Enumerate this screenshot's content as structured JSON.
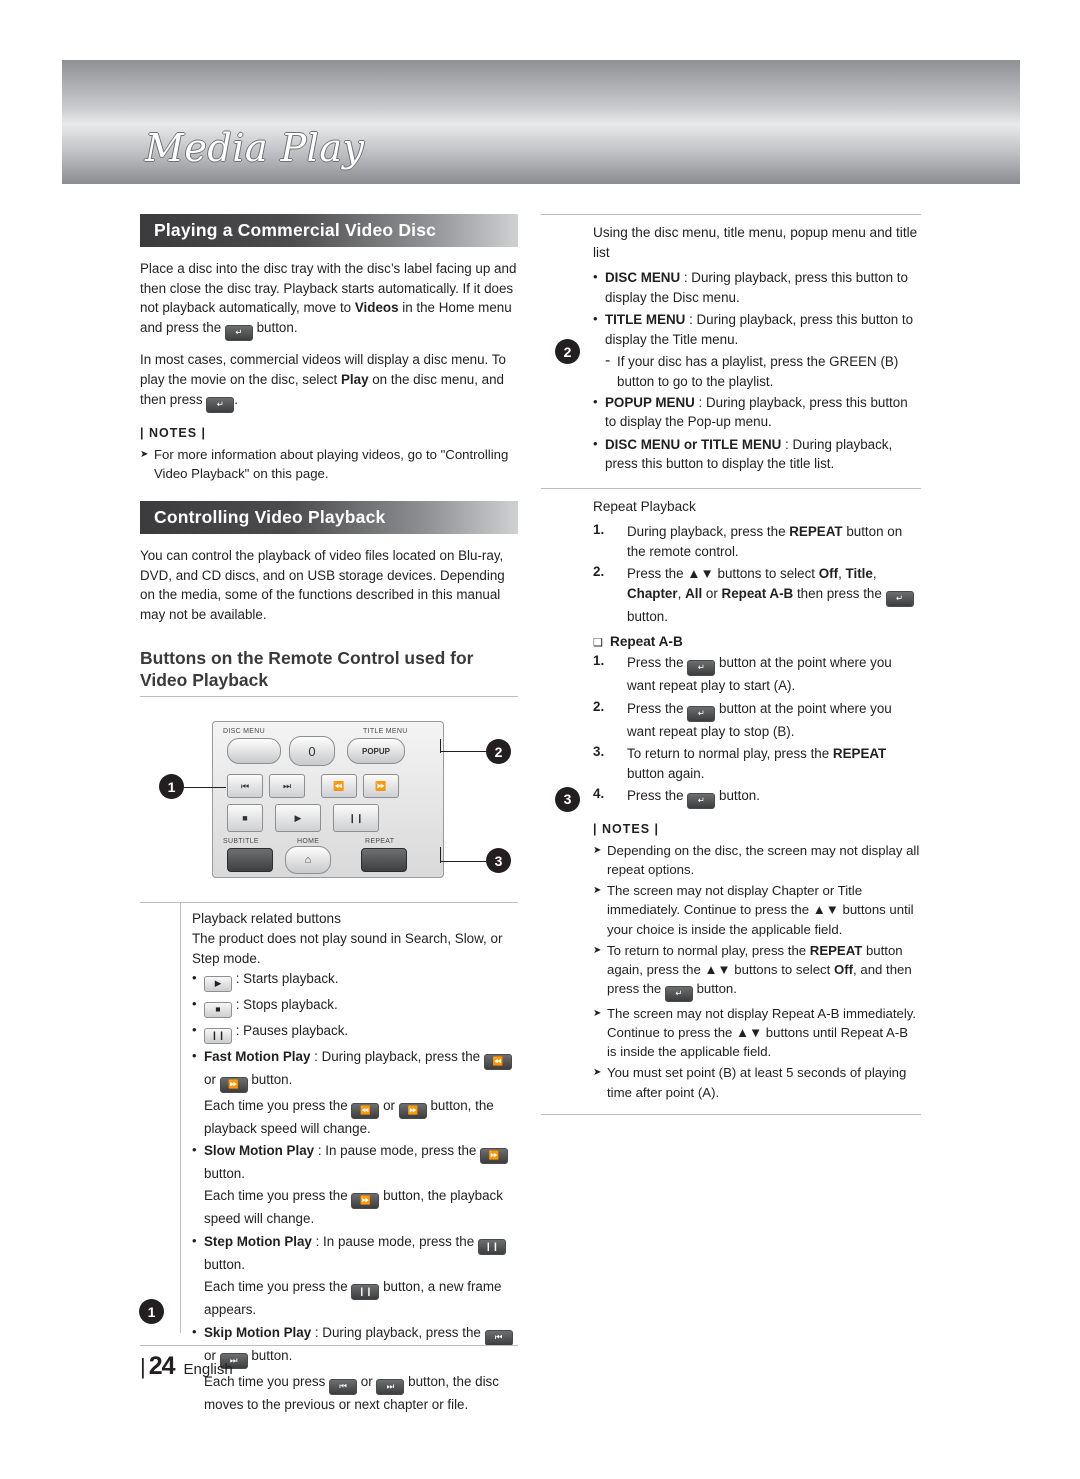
{
  "header": {
    "title": "Media Play"
  },
  "left": {
    "section1_title": "Playing a Commercial Video Disc",
    "p1": "Place a disc into the disc tray with the disc’s label facing up and then close the disc tray. Playback starts automatically. If it does not playback automatically, move to Videos in the Home menu and press the  button.",
    "p1_parts": {
      "a": "Place a disc into the disc tray with the disc’s label facing up and then close the disc tray. Playback starts automatically. If it does not playback automatically, move to ",
      "videos": "Videos",
      "b": " in the Home menu and press the ",
      "c": " button."
    },
    "p2_parts": {
      "a": "In most cases, commercial videos will display a disc menu. To play the movie on the disc, select ",
      "play": "Play",
      "b": " on the disc menu, and then press ",
      "c": "."
    },
    "notes_label": "NOTES",
    "note1": "For more information about playing videos, go to \"Controlling Video Playback\" on this page.",
    "section2_title": "Controlling Video Playback",
    "p3": "You can control the playback of video files located on Blu-ray, DVD, and CD discs, and on USB storage devices. Depending on the media, some of the functions described in this manual may not be available.",
    "section3_title": "Buttons on the Remote Control used for Video Playback",
    "remote": {
      "label_disc_menu": "DISC MENU",
      "label_title_menu": "TITLE MENU",
      "label_popup": "POPUP",
      "label_zero": "0",
      "label_subtitle": "SUBTITLE",
      "label_home": "HOME",
      "label_repeat": "REPEAT",
      "callout1": "1",
      "callout2": "2",
      "callout3": "3"
    },
    "panel": {
      "marker": "1",
      "title": "Playback related buttons",
      "intro": "The product does not play sound in Search, Slow, or Step mode.",
      "items": [
        {
          "kind": "bullet",
          "icon": "play",
          "text": ": Starts playback."
        },
        {
          "kind": "bullet",
          "icon": "stop",
          "text": ": Stops playback."
        },
        {
          "kind": "bullet",
          "icon": "pause",
          "text": ": Pauses playback."
        },
        {
          "kind": "bullet_bold",
          "bold": "Fast Motion Play",
          "text": " : During playback, press the  or  button."
        },
        {
          "kind": "sub",
          "text": "Each time you press the  or  button, the playback speed will change."
        },
        {
          "kind": "bullet_bold",
          "bold": "Slow Motion Play",
          "text": " : In pause mode, press the  button."
        },
        {
          "kind": "sub",
          "text": "Each time you press the  button, the playback speed will change."
        },
        {
          "kind": "bullet_bold",
          "bold": "Step Motion Play",
          "text": " : In pause mode, press the  button."
        },
        {
          "kind": "sub",
          "text": "Each time you press the  button, a new frame appears."
        },
        {
          "kind": "bullet_bold",
          "bold": "Skip Motion Play",
          "text": " : During playback, press the  or  button."
        },
        {
          "kind": "sub",
          "text": "Each time you press  or  button, the disc moves to the previous or next chapter or file."
        }
      ]
    }
  },
  "right": {
    "marker2": "2",
    "marker3": "3",
    "block1_head": "Using the disc menu, title menu, popup menu and title list",
    "block1_items": [
      {
        "bold": "DISC MENU",
        "text": " : During playback, press this button to display the Disc menu."
      },
      {
        "bold": "TITLE MENU",
        "text": " : During playback, press this button to display the Title menu."
      }
    ],
    "block1_dash": "If your disc has a playlist, press the GREEN (B) button to go to the playlist.",
    "block1_items2": [
      {
        "bold": "POPUP MENU",
        "text": " : During playback, press this button to display the Pop-up menu."
      },
      {
        "bold": "DISC MENU or TITLE MENU",
        "text": " : During playback, press this button to display the title list."
      }
    ],
    "block2_head": "Repeat Playback",
    "block2_steps": [
      {
        "n": "1.",
        "t": "During playback, press the REPEAT button on the remote control.",
        "bold": "REPEAT"
      },
      {
        "n": "2.",
        "t": "Press the ▲▼ buttons to select Off, Title, Chapter, All or Repeat A-B then press the  button."
      }
    ],
    "repeat_ab_head": "Repeat A-B",
    "repeat_ab_steps": [
      {
        "n": "1.",
        "t": "Press the  button at the point where you want repeat play to start (A)."
      },
      {
        "n": "2.",
        "t": "Press the  button at the point where you want repeat play to stop (B)."
      },
      {
        "n": "3.",
        "t": "To return to normal play, press the REPEAT button again."
      },
      {
        "n": "4.",
        "t": "Press the  button."
      }
    ],
    "notes_label": "NOTES",
    "notes": [
      "Depending on the disc, the screen may not display all repeat options.",
      "The screen may not display Chapter or Title immediately. Continue to press the ▲▼ buttons until your choice is inside the applicable field.",
      "To return to normal play, press the REPEAT button again, press the ▲▼ buttons to select Off, and then press the  button.",
      "The screen may not display Repeat A-B immediately. Continue to press the ▲▼ buttons until Repeat A-B is inside the applicable field.",
      "You must set point (B) at least 5 seconds of playing time after point (A)."
    ]
  },
  "footer": {
    "bar": "|",
    "page": "24",
    "language": "English"
  }
}
